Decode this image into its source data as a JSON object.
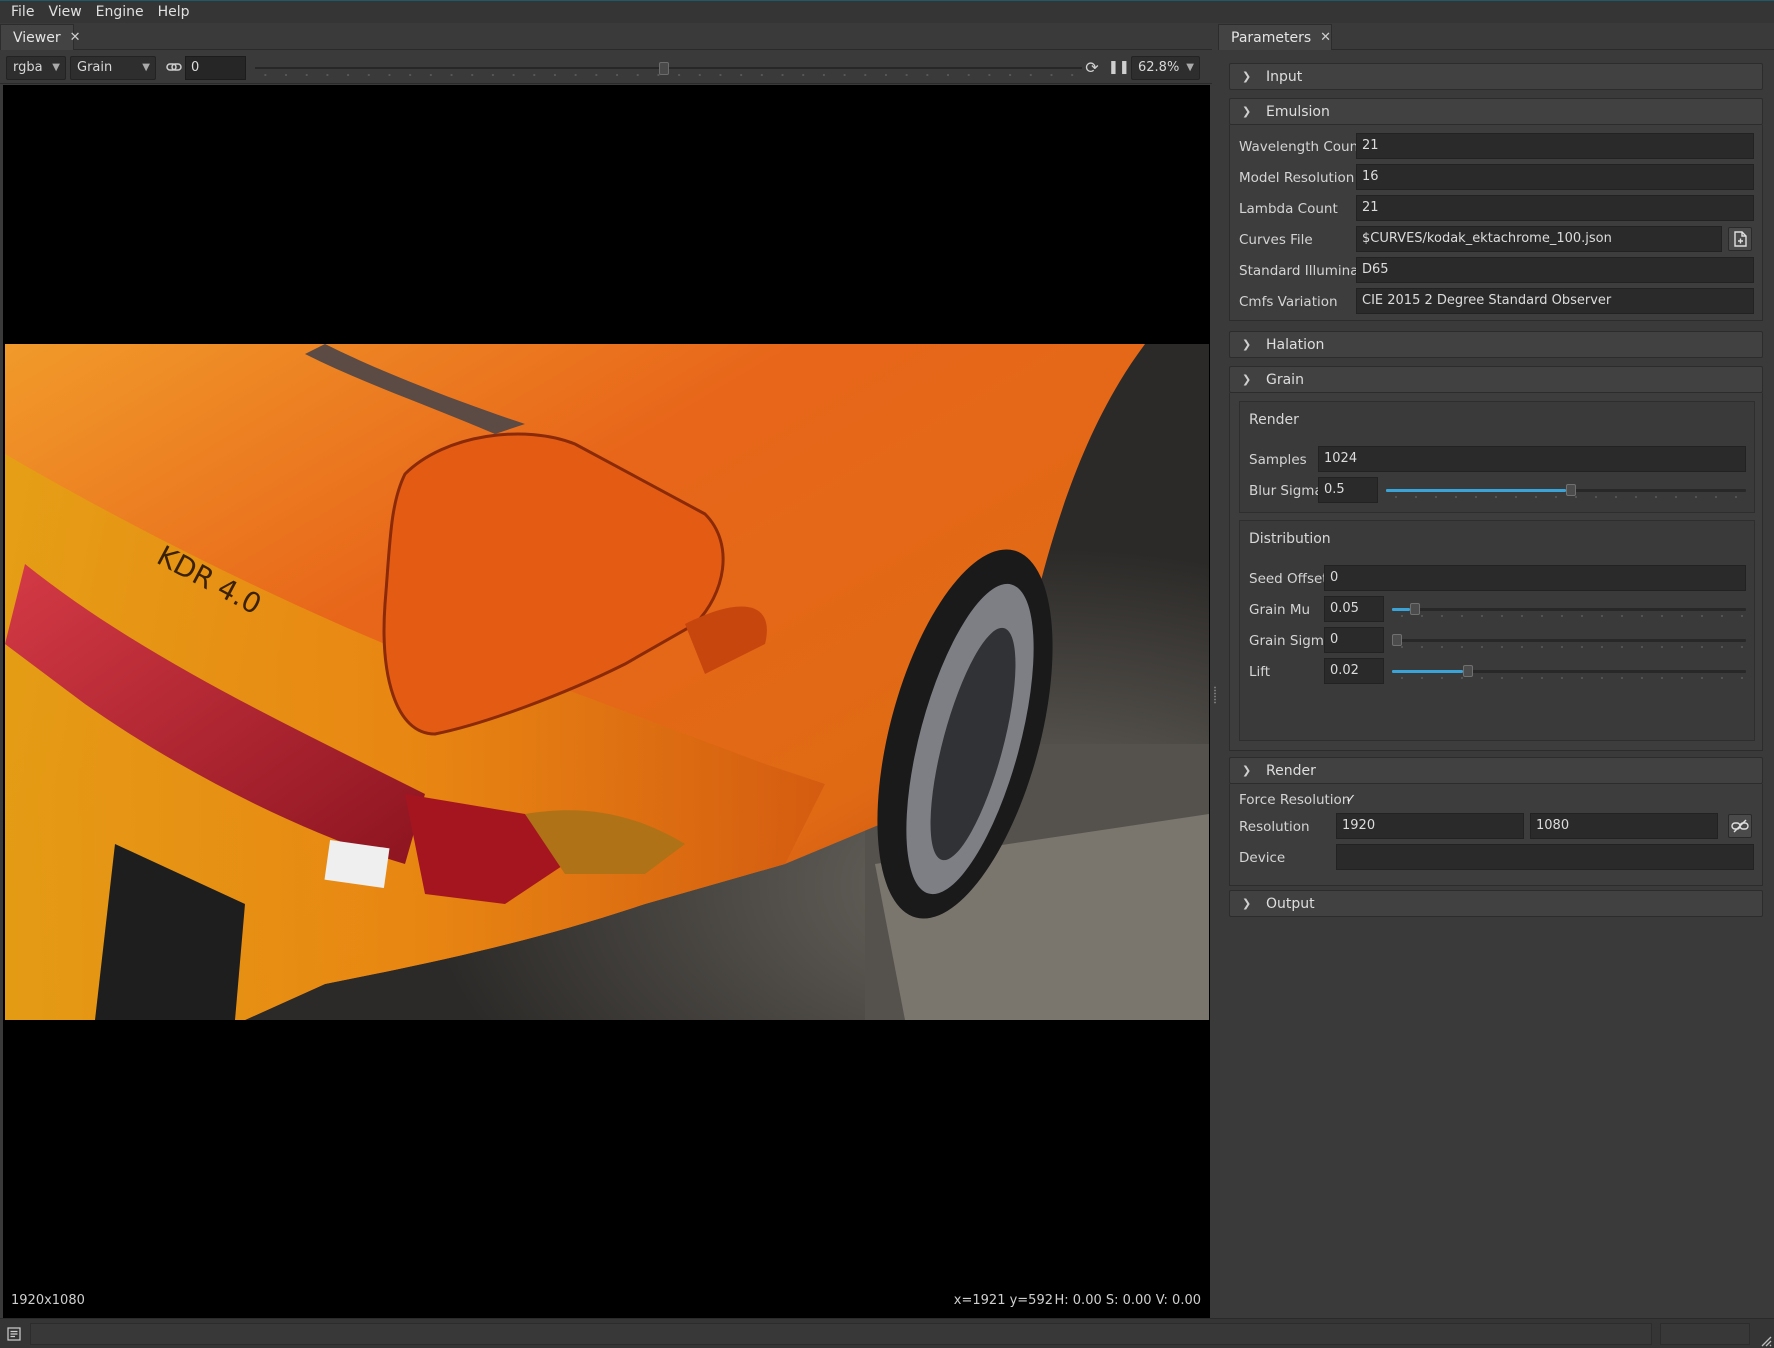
{
  "menu": {
    "file": "File",
    "view": "View",
    "engine": "Engine",
    "help": "Help"
  },
  "viewer": {
    "tab_label": "Viewer",
    "channel_select": "rgba",
    "stage_select": "Grain",
    "frame_value": "0",
    "timeline_position": 0.495,
    "zoom": "62.8%",
    "resolution_label": "1920x1080",
    "cursor_readout": "x=1921 y=592",
    "hsv_readout": "H: 0.00 S: 0.00 V: 0.00"
  },
  "params": {
    "tab_label": "Parameters",
    "input": {
      "title": "Input",
      "expanded": false
    },
    "emulsion": {
      "title": "Emulsion",
      "expanded": true,
      "wavelength_count_label": "Wavelength Count",
      "wavelength_count": "21",
      "model_resolution_label": "Model Resolution",
      "model_resolution": "16",
      "lambda_count_label": "Lambda Count",
      "lambda_count": "21",
      "curves_file_label": "Curves File",
      "curves_file": "$CURVES/kodak_ektachrome_100.json",
      "illuminant_label": "Standard Illuminant",
      "illuminant": "D65",
      "cmfs_label": "Cmfs Variation",
      "cmfs": "CIE 2015 2 Degree Standard Observer"
    },
    "halation": {
      "title": "Halation",
      "expanded": false
    },
    "grain": {
      "title": "Grain",
      "expanded": true,
      "render_group": "Render",
      "samples_label": "Samples",
      "samples": "1024",
      "blur_sigma_label": "Blur Sigma",
      "blur_sigma": "0.5",
      "blur_sigma_level": 0.5,
      "distribution_group": "Distribution",
      "seed_offset_label": "Seed Offset",
      "seed_offset": "0",
      "grain_mu_label": "Grain Mu",
      "grain_mu": "0.05",
      "grain_mu_level": 0.05,
      "grain_sigma_label": "Grain Sigma",
      "grain_sigma": "0",
      "grain_sigma_level": 0,
      "lift_label": "Lift",
      "lift": "0.02",
      "lift_level": 0.2
    },
    "render": {
      "title": "Render",
      "expanded": true,
      "force_resolution_label": "Force Resolution",
      "force_resolution_checked": true,
      "resolution_label": "Resolution",
      "resolution_width": "1920",
      "resolution_height": "1080",
      "device_label": "Device",
      "device": ""
    },
    "output": {
      "title": "Output",
      "expanded": false
    }
  },
  "colors": {
    "accent": "#3aa3d8",
    "background": "#3a3a3a",
    "field": "#2a2a2a"
  },
  "icons": [
    "link-icon",
    "refresh-icon",
    "pause-icon",
    "file-browse-icon",
    "unlink-icon",
    "log-icon",
    "resize-grip-icon"
  ]
}
